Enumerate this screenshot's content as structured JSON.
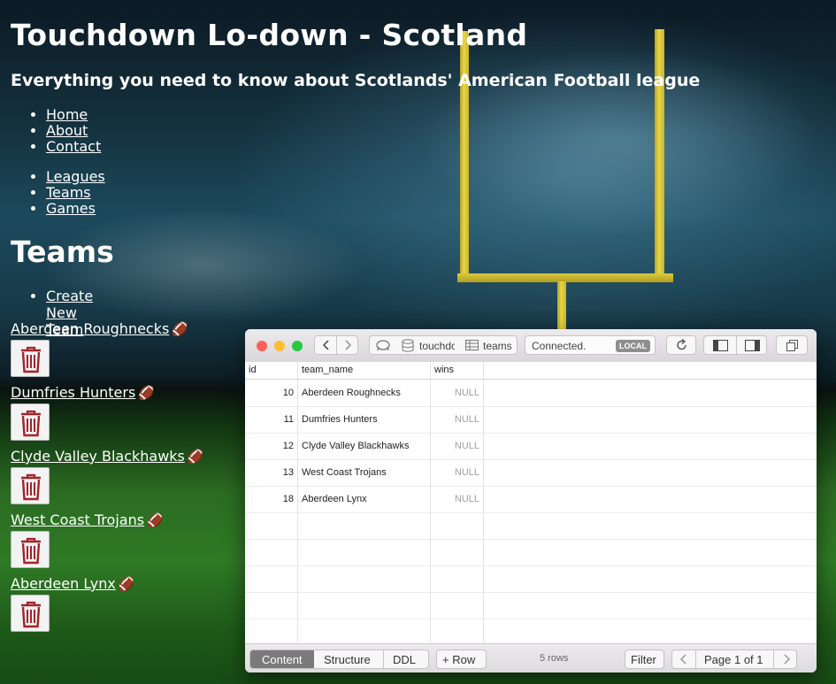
{
  "site": {
    "title": "Touchdown Lo-down - Scotland",
    "tagline": "Everything you need to know about Scotlands' American Football league",
    "nav_primary": [
      "Home",
      "About",
      "Contact"
    ],
    "nav_secondary": [
      "Leagues",
      "Teams",
      "Games"
    ],
    "page_heading": "Teams",
    "create_link": "Create New Team",
    "teams": [
      "Aberdeen Roughnecks",
      "Dumfries Hunters",
      "Clyde Valley Blackhawks",
      "West Coast Trojans",
      "Aberdeen Lynx"
    ],
    "team_icon": "american-football-emoji",
    "delete_icon": "trash-icon"
  },
  "db_window": {
    "database": "touchdc",
    "table": "teams",
    "status": "Connected.",
    "badge": "LOCAL",
    "columns": [
      "id",
      "team_name",
      "wins"
    ],
    "rows": [
      {
        "id": "10",
        "team_name": "Aberdeen Roughnecks",
        "wins": "NULL"
      },
      {
        "id": "11",
        "team_name": "Dumfries Hunters",
        "wins": "NULL"
      },
      {
        "id": "12",
        "team_name": "Clyde Valley Blackhawks",
        "wins": "NULL"
      },
      {
        "id": "13",
        "team_name": "West Coast Trojans",
        "wins": "NULL"
      },
      {
        "id": "18",
        "team_name": "Aberdeen Lynx",
        "wins": "NULL"
      }
    ],
    "tabs": [
      "Content",
      "Structure",
      "DDL"
    ],
    "active_tab": "Content",
    "add_row": "+ Row",
    "row_count": "5 rows",
    "filter": "Filter",
    "page": "Page 1 of 1"
  }
}
